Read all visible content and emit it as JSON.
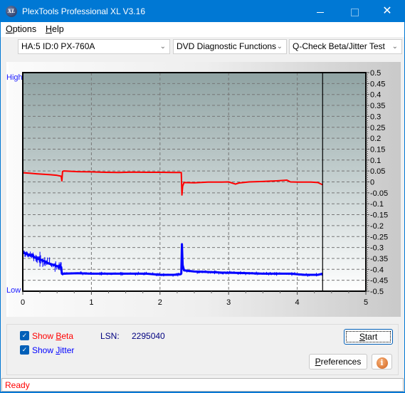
{
  "window": {
    "title": "PlexTools Professional XL V3.16",
    "app_icon_text": "XL",
    "controls": {
      "minimize": "minimize",
      "maximize": "maximize",
      "close": "✕"
    }
  },
  "menu": [
    {
      "label": "Options",
      "accel": "O",
      "rest": "ptions"
    },
    {
      "label": "Help",
      "accel": "H",
      "rest": "elp"
    }
  ],
  "toolbar": {
    "drive": "HA:5 ID:0  PX-760A",
    "function_group": "DVD Diagnostic Functions",
    "test": "Q-Check Beta/Jitter Test"
  },
  "chart_labels": {
    "high": "High",
    "low": "Low"
  },
  "chart_data": {
    "type": "line",
    "title": "",
    "xlabel": "",
    "ylabel": "",
    "xlim": [
      0,
      5
    ],
    "ylim": [
      -0.5,
      0.5
    ],
    "x_ticks": [
      "0",
      "1",
      "2",
      "3",
      "4",
      "5"
    ],
    "y_ticks_right": [
      "0.5",
      "0.45",
      "0.4",
      "0.35",
      "0.3",
      "0.25",
      "0.2",
      "0.15",
      "0.1",
      "0.05",
      "0",
      "-0.05",
      "-0.1",
      "-0.15",
      "-0.2",
      "-0.25",
      "-0.3",
      "-0.35",
      "-0.4",
      "-0.45",
      "-0.5"
    ],
    "grid": true,
    "marker_x": 4.37,
    "series": [
      {
        "name": "Beta",
        "color": "#ff0000",
        "x": [
          0,
          0.1,
          0.2,
          0.3,
          0.4,
          0.5,
          0.56,
          0.57,
          0.58,
          0.6,
          0.8,
          1.0,
          1.2,
          1.4,
          1.6,
          1.8,
          2.0,
          2.2,
          2.31,
          2.32,
          2.33,
          2.35,
          2.5,
          2.7,
          2.9,
          3.0,
          3.1,
          3.15,
          3.3,
          3.5,
          3.7,
          3.85,
          3.9,
          4.0,
          4.2,
          4.3,
          4.37
        ],
        "values": [
          0.042,
          0.04,
          0.037,
          0.035,
          0.033,
          0.03,
          0.026,
          0.005,
          0.048,
          0.05,
          0.047,
          0.046,
          0.044,
          0.043,
          0.045,
          0.044,
          0.044,
          0.043,
          0.043,
          -0.06,
          -0.02,
          -0.003,
          -0.004,
          -0.001,
          -0.001,
          0.0,
          -0.01,
          -0.005,
          0.0,
          0.002,
          0.005,
          0.008,
          0.0,
          -0.001,
          -0.001,
          -0.003,
          -0.013
        ]
      },
      {
        "name": "Jitter",
        "color": "#0000ff",
        "x": [
          0,
          0.05,
          0.1,
          0.15,
          0.2,
          0.25,
          0.3,
          0.35,
          0.4,
          0.45,
          0.5,
          0.56,
          0.57,
          0.6,
          0.8,
          1.0,
          1.2,
          1.4,
          1.6,
          1.8,
          2.0,
          2.2,
          2.3,
          2.31,
          2.32,
          2.33,
          2.35,
          2.5,
          2.7,
          2.9,
          3.1,
          3.3,
          3.5,
          3.7,
          3.9,
          4.1,
          4.3,
          4.37
        ],
        "values": [
          -0.32,
          -0.33,
          -0.335,
          -0.34,
          -0.35,
          -0.355,
          -0.36,
          -0.37,
          -0.375,
          -0.38,
          -0.385,
          -0.39,
          -0.42,
          -0.42,
          -0.418,
          -0.42,
          -0.42,
          -0.42,
          -0.42,
          -0.42,
          -0.425,
          -0.425,
          -0.422,
          -0.42,
          -0.285,
          -0.38,
          -0.405,
          -0.41,
          -0.412,
          -0.415,
          -0.416,
          -0.418,
          -0.42,
          -0.42,
          -0.42,
          -0.425,
          -0.425,
          -0.42
        ]
      }
    ]
  },
  "controls": {
    "show_beta": {
      "label_pre": "Show ",
      "accel": "B",
      "label_post": "eta",
      "checked": true,
      "color": "#ff0000"
    },
    "show_jitter": {
      "label_pre": "Show ",
      "accel": "J",
      "label_post": "itter",
      "checked": true,
      "color": "#0000ff"
    },
    "lsn_label": "LSN:",
    "lsn_value": "2295040",
    "start_button": {
      "accel": "S",
      "rest": "tart"
    },
    "preferences_button": {
      "accel": "P",
      "rest": "references"
    },
    "info_button": "i"
  },
  "status": {
    "text": "Ready"
  }
}
